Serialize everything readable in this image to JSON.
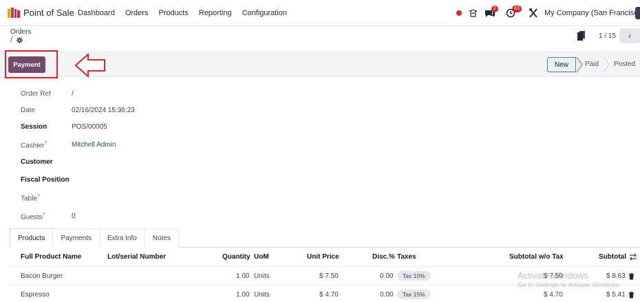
{
  "app": {
    "name": "Point of Sale",
    "menu": [
      "Dashboard",
      "Orders",
      "Products",
      "Reporting",
      "Configuration"
    ],
    "messages_count": "2",
    "activities_count": "43",
    "company": "My Company (San Francisco)"
  },
  "breadcrumb": {
    "parent": "Orders",
    "current": "/"
  },
  "pager": {
    "text": "1 / 15"
  },
  "actions": {
    "payment_label": "Payment"
  },
  "stages": {
    "items": [
      "New",
      "Paid",
      "Posted"
    ],
    "active": "New"
  },
  "form": {
    "order_ref": {
      "label": "Order Ref",
      "value": "/"
    },
    "date": {
      "label": "Date",
      "value": "02/16/2024 15:36:23"
    },
    "session": {
      "label": "Session",
      "value": "POS/00005"
    },
    "cashier": {
      "label": "Cashier",
      "value": "Mitchell Admin"
    },
    "customer": {
      "label": "Customer",
      "value": ""
    },
    "fiscal_position": {
      "label": "Fiscal Position",
      "value": ""
    },
    "table": {
      "label": "Table",
      "value": ""
    },
    "guests": {
      "label": "Guests",
      "value": "0"
    },
    "help_mark": "?"
  },
  "tabs": [
    "Products",
    "Payments",
    "Extra Info",
    "Notes"
  ],
  "lines": {
    "headers": {
      "product": "Full Product Name",
      "lot": "Lot/serial Number",
      "qty": "Quantity",
      "uom": "UoM",
      "price": "Unit Price",
      "disc": "Disc.%",
      "taxes": "Taxes",
      "subtotal_wo_tax": "Subtotal w/o Tax",
      "subtotal": "Subtotal"
    },
    "rows": [
      {
        "product": "Bacon Burger",
        "qty": "1.00",
        "uom": "Units",
        "price": "$ 7.50",
        "disc": "0.00",
        "tax": "Tax 15%",
        "subtotal_wo_tax": "$ 7.50",
        "subtotal": "$ 8.63"
      },
      {
        "product": "Espresso",
        "qty": "1.00",
        "uom": "Units",
        "price": "$ 4.70",
        "disc": "0.00",
        "tax": "Tax 15%",
        "subtotal_wo_tax": "$ 4.70",
        "subtotal": "$ 5.41"
      }
    ]
  },
  "watermark": {
    "line1": "Activate Windows",
    "line2": "Go to Settings to activate Windows."
  },
  "colors": {
    "brand": "#714b67",
    "highlight": "#dc2626",
    "stage_active_bg": "#e6f2f3"
  }
}
